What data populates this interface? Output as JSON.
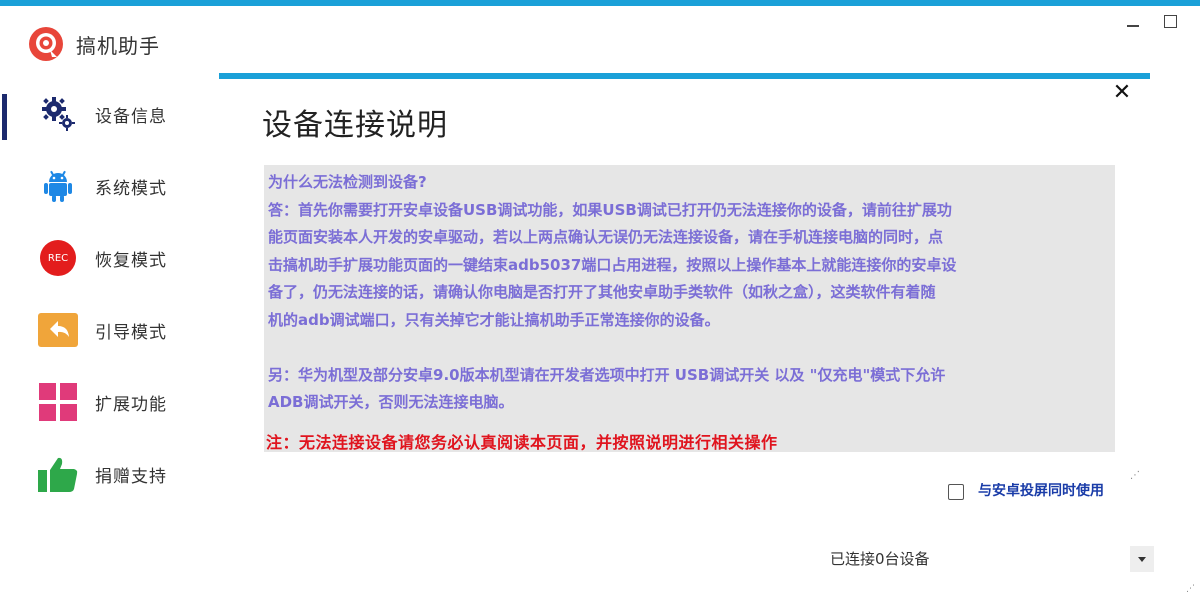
{
  "app": {
    "title": "搞机助手",
    "accent_color": "#1aa0d8"
  },
  "window_controls": {
    "minimize_icon": "minimize-icon",
    "maximize_icon": "maximize-icon"
  },
  "sidebar": {
    "items": [
      {
        "label": "设备信息",
        "icon": "gears-icon",
        "active": true
      },
      {
        "label": "系统模式",
        "icon": "android-icon",
        "active": false
      },
      {
        "label": "恢复模式",
        "icon": "rec-icon",
        "icon_text": "REC",
        "active": false
      },
      {
        "label": "引导模式",
        "icon": "back-arrow-icon",
        "active": false
      },
      {
        "label": "扩展功能",
        "icon": "grid-icon",
        "active": false
      },
      {
        "label": "捐赠支持",
        "icon": "thumbs-up-icon",
        "active": false
      }
    ]
  },
  "dialog": {
    "title": "设备连接说明",
    "close_icon": "close-icon",
    "question": "为什么无法检测到设备?",
    "answer_lines": [
      "答：首先你需要打开安卓设备USB调试功能，如果USB调试已打开仍无法连接你的设备，请前往扩展功",
      "能页面安装本人开发的安卓驱动，若以上两点确认无误仍无法连接设备，请在手机连接电脑的同时，点",
      "击搞机助手扩展功能页面的一键结束adb5037端口占用进程，按照以上操作基本上就能连接你的安卓设",
      "备了，仍无法连接的话，请确认你电脑是否打开了其他安卓助手类软件（如秋之盒），这类软件有着随",
      "机的adb调试端口，只有关掉它才能让搞机助手正常连接你的设备。"
    ],
    "note_lines": [
      "另：华为机型及部分安卓9.0版本机型请在开发者选项中打开 USB调试开关 以及 \"仅充电\"模式下允许",
      "ADB调试开关，否则无法连接电脑。"
    ],
    "warning": "注：无法连接设备请您务必认真阅读本页面，并按照说明进行相关操作",
    "text_color": "#7b6ed6",
    "warning_color": "#e0141e"
  },
  "sync_option": {
    "label": "与安卓投屏同时使用",
    "checked": false
  },
  "status": {
    "text": "已连接0台设备"
  }
}
